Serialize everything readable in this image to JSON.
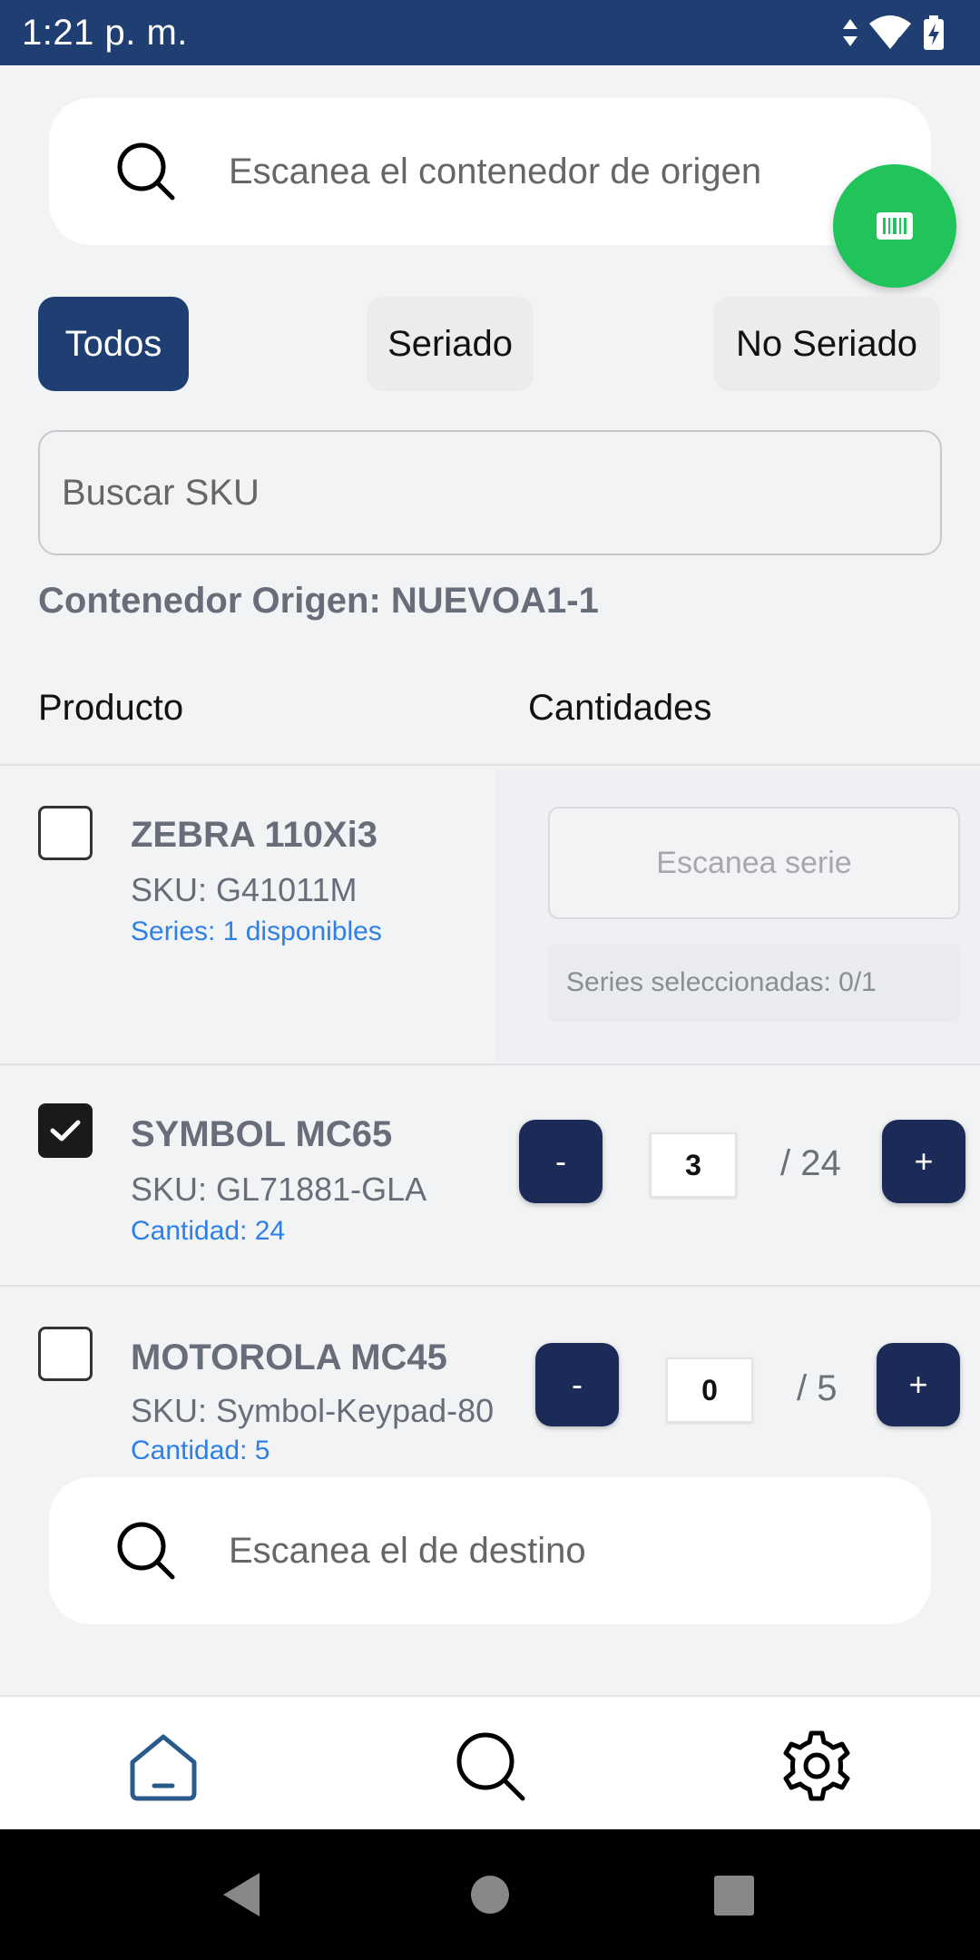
{
  "status_bar": {
    "time": "1:21 p. m.",
    "signal_label": "4"
  },
  "origin_search": {
    "placeholder": "Escanea el contenedor de origen",
    "icon": "search-icon"
  },
  "scan_fab": {
    "icon": "barcode-icon",
    "color": "#20c45b"
  },
  "filters": [
    {
      "label": "Todos",
      "active": true
    },
    {
      "label": "Seriado",
      "active": false
    },
    {
      "label": "No Seriado",
      "active": false
    }
  ],
  "sku_search": {
    "placeholder": "Buscar SKU"
  },
  "origin_label": "Contenedor Origen: NUEVOA1-1",
  "columns": {
    "product": "Producto",
    "quantities": "Cantidades"
  },
  "products": [
    {
      "name": "ZEBRA 110Xi3",
      "sku": "SKU: G41011M",
      "info": "Series: 1 disponibles",
      "checked": false,
      "serial_placeholder": "Escanea serie",
      "serial_count": "Series seleccionadas: 0/1"
    },
    {
      "name": "SYMBOL MC65",
      "sku": "SKU: GL71881-GLA",
      "info": "Cantidad: 24",
      "checked": true,
      "minus": "-",
      "qty": "3",
      "total": "/ 24",
      "plus": "+"
    },
    {
      "name": "MOTOROLA MC45",
      "sku": "SKU: Symbol-Keypad-80",
      "info": "Cantidad: 5",
      "checked": false,
      "minus": "-",
      "qty": "0",
      "total": "/ 5",
      "plus": "+"
    }
  ],
  "dest_search": {
    "placeholder": "Escanea el de destino",
    "icon": "search-icon"
  },
  "bottom_nav": [
    {
      "icon": "home-icon",
      "active": true
    },
    {
      "icon": "search-icon",
      "active": false
    },
    {
      "icon": "gear-icon",
      "active": false
    }
  ],
  "colors": {
    "primary": "#1f3e72",
    "accent_green": "#20c45b",
    "link_blue": "#2f80e6",
    "stepper": "#1b2a57"
  }
}
